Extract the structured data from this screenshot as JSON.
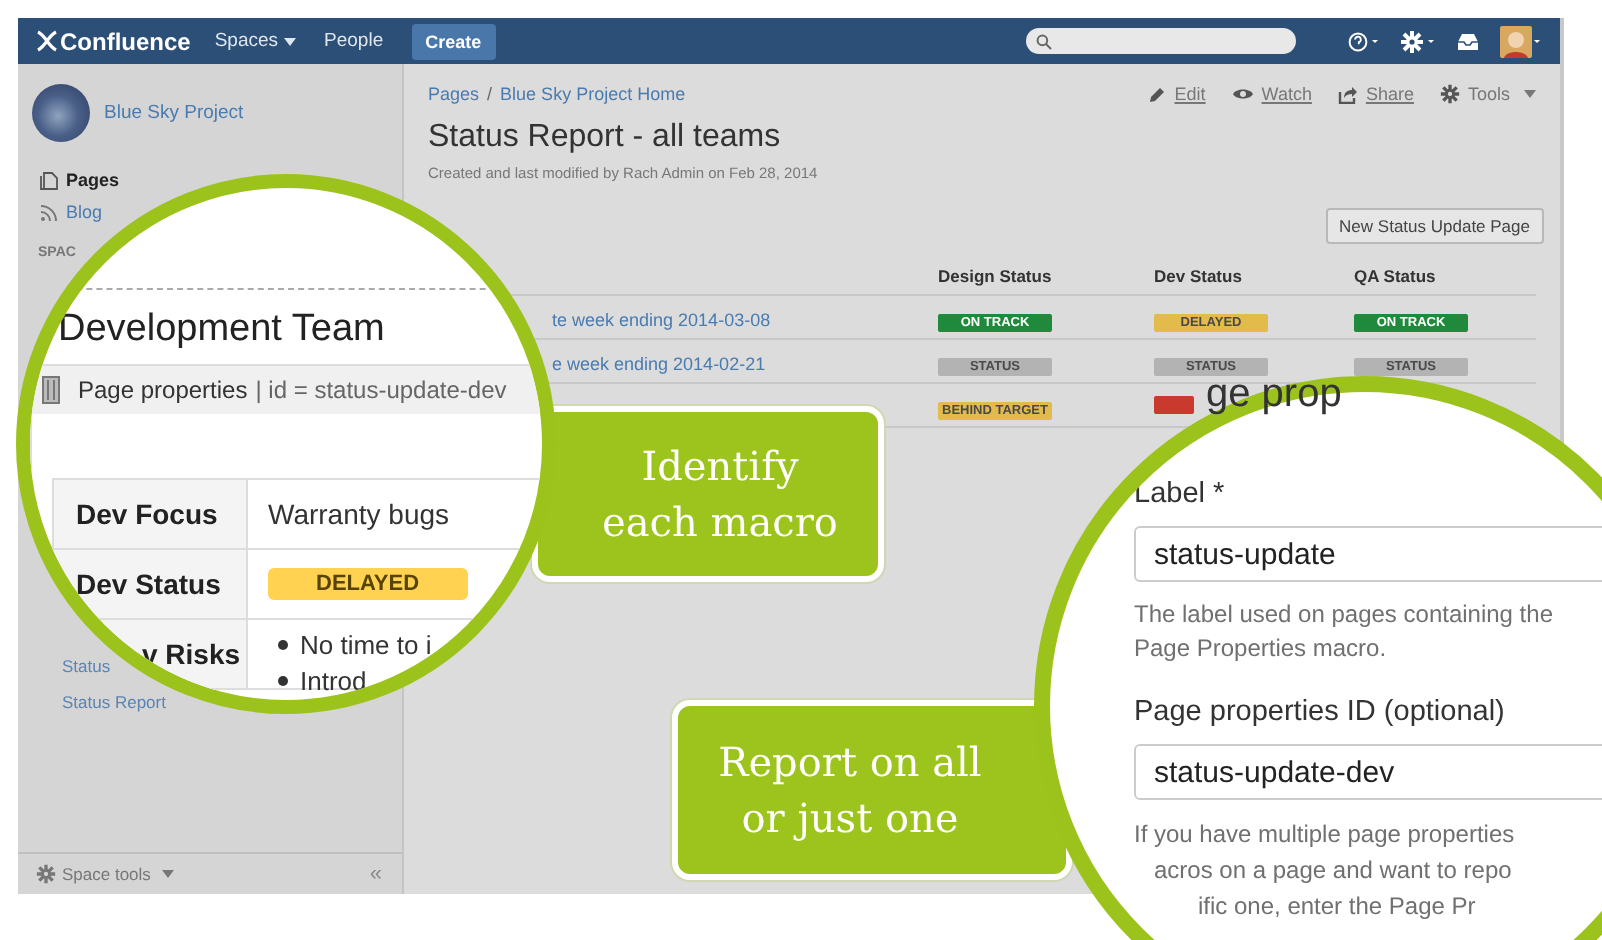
{
  "header": {
    "logo": "Confluence",
    "nav": [
      {
        "label": "Spaces",
        "dropdown": true
      },
      {
        "label": "People",
        "dropdown": false
      }
    ],
    "create": "Create"
  },
  "sidebar": {
    "space_name": "Blue Sky Project",
    "nav": [
      {
        "label": "Pages",
        "selected": true
      },
      {
        "label": "Blog",
        "selected": false
      }
    ],
    "section_heading": "SPAC",
    "tree_items": [
      "Status",
      "Status Report"
    ],
    "space_tools": "Space tools",
    "collapse": "«"
  },
  "page": {
    "breadcrumbs": [
      "Pages",
      "Blue Sky Project Home"
    ],
    "separator": "/",
    "actions": [
      {
        "label": "Edit",
        "dropdown": false
      },
      {
        "label": "Watch",
        "dropdown": false
      },
      {
        "label": "Share",
        "dropdown": false
      },
      {
        "label": "Tools",
        "dropdown": true
      }
    ],
    "title": "Status Report - all teams",
    "byline": "Created and last modified by Rach Admin on Feb 28, 2014",
    "new_button": "New Status Update Page",
    "columns": [
      "Design Status",
      "Dev Status",
      "QA Status"
    ],
    "rows": [
      {
        "link": "te week ending 2014-03-08",
        "statuses": [
          {
            "text": "ON TRACK",
            "color": "#1f8a3b"
          },
          {
            "text": "DELAYED",
            "color": "#e3bb4c"
          },
          {
            "text": "ON TRACK",
            "color": "#1f8a3b"
          }
        ]
      },
      {
        "link": "e week ending 2014-02-21",
        "statuses": [
          {
            "text": "STATUS",
            "color": "#b3b3b3"
          },
          {
            "text": "STATUS",
            "color": "#b3b3b3"
          },
          {
            "text": "STATUS",
            "color": "#b3b3b3"
          }
        ]
      },
      {
        "statuses": [
          {
            "text": "BEHIND TARGET",
            "color": "#e3bb4c"
          },
          {
            "color": "#c9392e"
          }
        ]
      }
    ]
  },
  "callouts": [
    {
      "lines": [
        "Identify",
        "each macro"
      ]
    },
    {
      "lines": [
        "Report on all",
        "or just one"
      ]
    }
  ],
  "zoom_macro": {
    "heading": "Development Team",
    "macro_name": "Page properties",
    "macro_params": "| id = status-update-dev",
    "rows": [
      {
        "kind": "text",
        "key": "Dev Focus",
        "value": "Warranty bugs"
      },
      {
        "kind": "status",
        "key": "Dev Status",
        "value": "DELAYED"
      },
      {
        "kind": "list",
        "key": "v Risks",
        "items": [
          "No time to i",
          "Introd"
        ]
      }
    ]
  },
  "zoom_dialog": {
    "heading": "ge prop",
    "fields": [
      {
        "label": "Label *",
        "value": "status-update",
        "help": [
          "The label used on pages containing the Page Properties macro."
        ]
      },
      {
        "label": "Page properties ID (optional)",
        "value": "status-update-dev",
        "help": [
          "If you have multiple page properties",
          "acros on a page and want to repo",
          "ific one, enter the Page Pr"
        ]
      }
    ]
  }
}
